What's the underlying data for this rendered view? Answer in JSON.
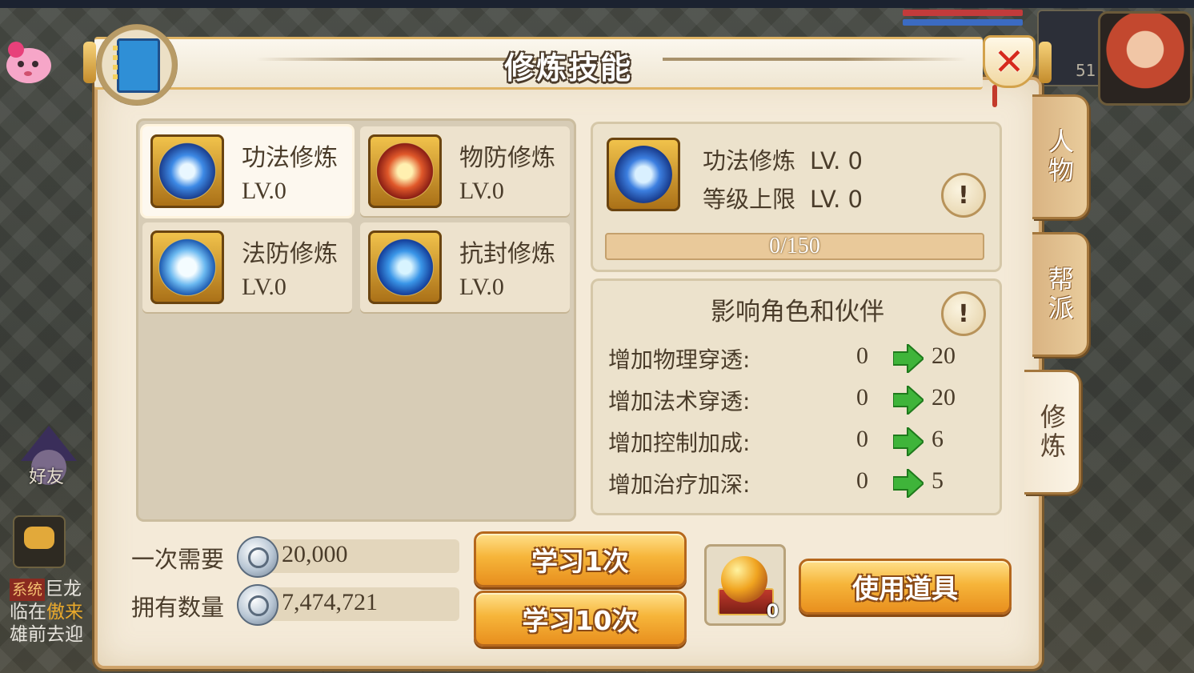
{
  "window": {
    "title": "修炼技能"
  },
  "hud": {
    "level": "51"
  },
  "left_hud": {
    "friend_label": "好友",
    "chat": {
      "tag": "系统",
      "line1": "巨龙",
      "line2a": "临在",
      "line2b": "傲来",
      "line3": "雄前去迎"
    }
  },
  "skills": [
    {
      "name": "功法修炼",
      "level": "LV.0",
      "icon": "blue-rune-icon",
      "selected": true
    },
    {
      "name": "物防修炼",
      "level": "LV.0",
      "icon": "red-shield-rune-icon",
      "selected": false
    },
    {
      "name": "法防修炼",
      "level": "LV.0",
      "icon": "blue-cloud-rune-icon",
      "selected": false
    },
    {
      "name": "抗封修炼",
      "level": "LV.0",
      "icon": "blue-swirl-rune-icon",
      "selected": false
    }
  ],
  "detail": {
    "name": "功法修炼",
    "level": "LV. 0",
    "limit_label": "等级上限",
    "limit_value": "LV. 0",
    "progress_text": "0/150",
    "progress_fraction": 0
  },
  "effects": {
    "title": "影响角色和伙伴",
    "rows": [
      {
        "label": "增加物理穿透:",
        "current": "0",
        "next": "20"
      },
      {
        "label": "增加法术穿透:",
        "current": "0",
        "next": "20"
      },
      {
        "label": "增加控制加成:",
        "current": "0",
        "next": "6"
      },
      {
        "label": "增加治疗加深:",
        "current": "0",
        "next": "5"
      }
    ]
  },
  "tabs": [
    {
      "label": "人物",
      "active": false
    },
    {
      "label": "帮派",
      "active": false
    },
    {
      "label": "修炼",
      "active": true
    }
  ],
  "cost": {
    "need_label": "一次需要",
    "need_value": "20,000",
    "own_label": "拥有数量",
    "own_value": "7,474,721"
  },
  "buttons": {
    "learn_once": "学习1次",
    "learn_ten": "学习10次",
    "use_item": "使用道具"
  },
  "item": {
    "count": "0"
  },
  "colors": {
    "accent_gold": "#f6b53a",
    "arrow_green": "#3fb43a",
    "close_red": "#d62a1d"
  }
}
